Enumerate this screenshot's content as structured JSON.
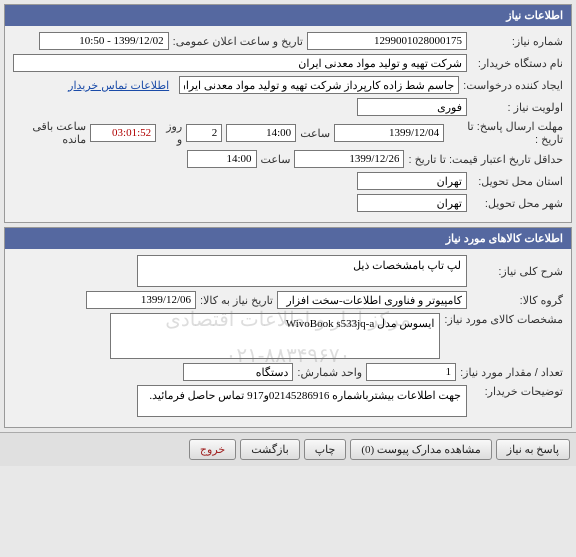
{
  "panel1": {
    "title": "اطلاعات نیاز",
    "need_number_label": "شماره نیاز:",
    "need_number": "1299001028000175",
    "announce_label": "تاریخ و ساعت اعلان عمومی:",
    "announce_value": "1399/12/02 - 10:50",
    "buyer_label": "نام دستگاه خریدار:",
    "buyer_value": "شرکت تهیه و تولید مواد معدنی ایران",
    "creator_label": "ایجاد کننده درخواست:",
    "creator_value": "جاسم شط زاده کارپرداز شرکت تهیه و تولید مواد معدنی ایران",
    "contact_link": "اطلاعات تماس خریدار",
    "priority_label": "اولویت نیاز :",
    "priority_value": "فوری",
    "deadline_label": "مهلت ارسال پاسخ:",
    "to_date_label": "تا تاریخ :",
    "deadline_date": "1399/12/04",
    "time_label": "ساعت",
    "deadline_time": "14:00",
    "days": "2",
    "days_label": "روز و",
    "countdown": "03:01:52",
    "remaining_label": "ساعت باقی مانده",
    "min_credit_label": "حداقل تاریخ اعتبار قیمت:",
    "min_credit_to": "تا تاریخ :",
    "min_credit_date": "1399/12/26",
    "min_credit_time": "14:00",
    "delivery_province_label": "استان محل تحویل:",
    "delivery_province": "تهران",
    "delivery_city_label": "شهر محل تحویل:",
    "delivery_city": "تهران"
  },
  "panel2": {
    "title": "اطلاعات کالاهای مورد نیاز",
    "summary_label": "شرح کلی نیاز:",
    "summary_value": "لپ تاپ بامشخصات ذیل",
    "group_label": "گروه کالا:",
    "group_value": "کامپیوتر و فناوری اطلاعات-سخت افزار",
    "need_date_label": "تاریخ نیاز به کالا:",
    "need_date": "1399/12/06",
    "spec_label": "مشخصات کالای مورد نیاز:",
    "spec_value": "ایسوس مدل WivoBook s533jq-a",
    "qty_label": "تعداد / مقدار مورد نیاز:",
    "qty_value": "1",
    "unit_label": "واحد شمارش:",
    "unit_value": "دستگاه",
    "notes_label": "توضیحات خریدار:",
    "notes_value": "جهت اطلاعات بیشترباشماره 02145286916و917 تماس حاصل فرمائید.",
    "watermark1": "مرکز آمار و اطلاعات اقتصادی",
    "watermark2": "۰۲۱-۸۸۳۴۹۶۷۰"
  },
  "footer": {
    "respond": "پاسخ به نیاز",
    "view": "مشاهده مدارک پیوست",
    "view_count": "(0)",
    "print": "چاپ",
    "back": "بازگشت",
    "exit": "خروج"
  }
}
